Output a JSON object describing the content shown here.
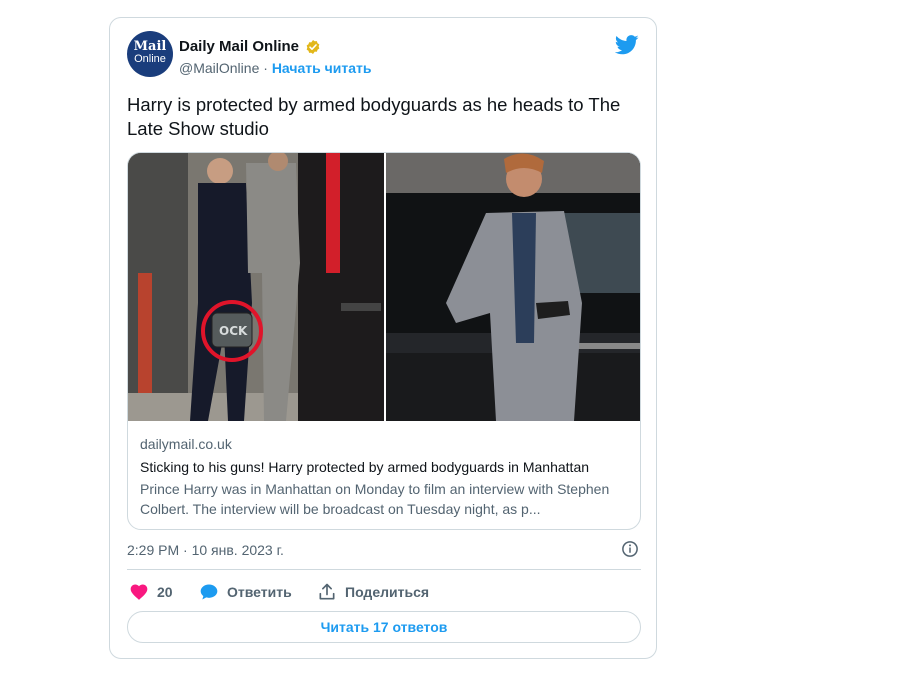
{
  "tweet": {
    "avatar": {
      "line1": "Mail",
      "line2": "Online"
    },
    "author_name": "Daily Mail Online",
    "handle": "@MailOnline",
    "separator": " · ",
    "follow_label": "Начать читать",
    "text": "Harry is protected by armed bodyguards as he heads to The Late Show studio",
    "timestamp": "2:29 PM · 10 янв. 2023 г.",
    "likes": "20",
    "reply_label": "Ответить",
    "share_label": "Поделиться",
    "read_replies_label": "Читать 17 ответов"
  },
  "link_card": {
    "domain": "dailymail.co.uk",
    "title": "Sticking to his guns! Harry protected by armed bodyguards in Manhattan",
    "description": "Prince Harry was in Manhattan on Monday to film an interview with Stephen Colbert. The interview will be broadcast on Tuesday night, as p...",
    "photo_left_caption": "OCK"
  },
  "colors": {
    "accent": "#1d9bf0",
    "like": "#f91880",
    "verified": "#e2b719",
    "brand": "#1a3d7c",
    "border": "#cfd9de",
    "muted": "#536471"
  },
  "icons": [
    "verified-badge-icon",
    "twitter-bird-icon",
    "heart-icon",
    "reply-icon",
    "share-icon",
    "info-icon"
  ]
}
